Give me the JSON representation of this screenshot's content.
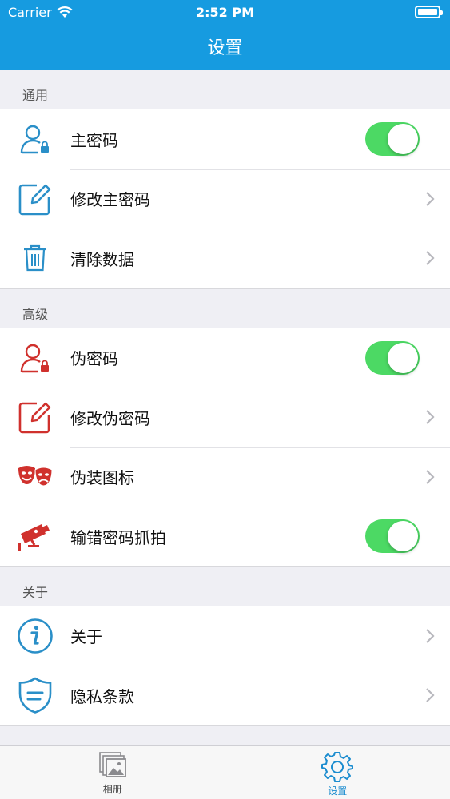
{
  "status_bar": {
    "carrier": "Carrier",
    "time": "2:52 PM"
  },
  "nav": {
    "title": "设置"
  },
  "sections": [
    {
      "header": "通用",
      "rows": [
        {
          "label": "主密码",
          "icon": "user-lock-icon",
          "accessory": "toggle",
          "on": true
        },
        {
          "label": "修改主密码",
          "icon": "edit-icon",
          "accessory": "chevron"
        },
        {
          "label": "清除数据",
          "icon": "trash-icon",
          "accessory": "chevron"
        }
      ]
    },
    {
      "header": "高级",
      "rows": [
        {
          "label": "伪密码",
          "icon": "user-lock-icon",
          "accessory": "toggle",
          "on": true
        },
        {
          "label": "修改伪密码",
          "icon": "edit-icon",
          "accessory": "chevron"
        },
        {
          "label": "伪装图标",
          "icon": "masks-icon",
          "accessory": "chevron"
        },
        {
          "label": "输错密码抓拍",
          "icon": "camera-icon",
          "accessory": "toggle",
          "on": true
        }
      ]
    },
    {
      "header": "关于",
      "rows": [
        {
          "label": "关于",
          "icon": "info-icon",
          "accessory": "chevron"
        },
        {
          "label": "隐私条款",
          "icon": "shield-icon",
          "accessory": "chevron"
        }
      ]
    }
  ],
  "tabbar": {
    "tabs": [
      {
        "label": "相册",
        "icon": "album-icon"
      },
      {
        "label": "设置",
        "icon": "gear-icon"
      }
    ]
  },
  "colors": {
    "nav": "#169be0",
    "blue_icon": "#2a8fc8",
    "red_icon": "#d0312d",
    "toggle_on": "#4cd964",
    "tab_active": "#1b8ccf"
  }
}
